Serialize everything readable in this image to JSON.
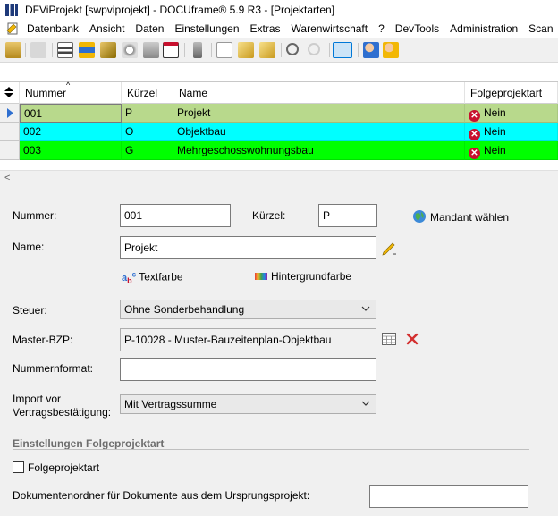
{
  "window": {
    "title": "DFViProjekt [swpviprojekt] - DOCUframe® 5.9 R3 - [Projektarten]"
  },
  "menu": {
    "items": [
      "Datenbank",
      "Ansicht",
      "Daten",
      "Einstellungen",
      "Extras",
      "Warenwirtschaft",
      "?",
      "DevTools",
      "Administration",
      "Scan"
    ]
  },
  "grid": {
    "columns": {
      "nummer": "Nummer",
      "kuerzel": "Kürzel",
      "name": "Name",
      "folge": "Folgeprojektart"
    },
    "rows": [
      {
        "nummer": "001",
        "kuerzel": "P",
        "name": "Projekt",
        "folge": "Nein",
        "color": "#b8d98c"
      },
      {
        "nummer": "002",
        "kuerzel": "O",
        "name": "Objektbau",
        "folge": "Nein",
        "color": "#00ffff"
      },
      {
        "nummer": "003",
        "kuerzel": "G",
        "name": "Mehrgeschosswohnungsbau",
        "folge": "Nein",
        "color": "#00ff00"
      }
    ],
    "scroll_left": "<"
  },
  "form": {
    "nummer_label": "Nummer:",
    "nummer_value": "001",
    "kuerzel_label": "Kürzel:",
    "kuerzel_value": "P",
    "mandant_label": "Mandant wählen",
    "name_label": "Name:",
    "name_value": "Projekt",
    "textfarbe_label": "Textfarbe",
    "hintergrundfarbe_label": "Hintergrundfarbe",
    "steuer_label": "Steuer:",
    "steuer_value": "Ohne Sonderbehandlung",
    "master_label": "Master-BZP:",
    "master_value": "P-10028 - Muster-Bauzeitenplan-Objektbau",
    "nummernformat_label": "Nummernformat:",
    "nummernformat_value": "",
    "import_label_1": "Import vor",
    "import_label_2": "Vertragsbestätigung:",
    "import_value": "Mit Vertragssumme",
    "section_title": "Einstellungen Folgeprojektart",
    "folge_checkbox_label": "Folgeprojektart",
    "dokordner_label": "Dokumentenordner für Dokumente aus dem Ursprungsprojekt:",
    "dokordner_value": ""
  },
  "colors": {
    "accent": "#0078d7",
    "no_icon": "#c8102e"
  }
}
